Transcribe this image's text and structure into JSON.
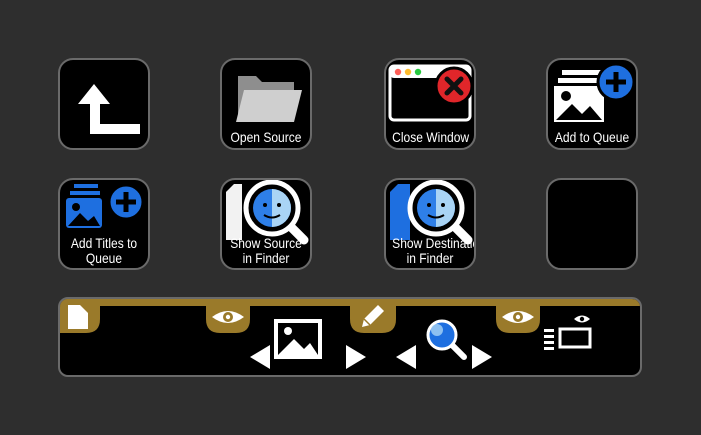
{
  "keys": {
    "back": {
      "label": ""
    },
    "open_source": {
      "label": "Open Source"
    },
    "close_window": {
      "label": "Close Window"
    },
    "add_to_queue": {
      "label": "Add to Queue"
    },
    "add_titles": {
      "line1": "Add Titles to",
      "line2": "Queue"
    },
    "show_source": {
      "line1": "Show Source",
      "line2": "in Finder"
    },
    "show_destination": {
      "line1": "Show Destination",
      "line2": "in Finder"
    },
    "empty": {
      "label": ""
    }
  },
  "icons": {
    "back": "up-left-arrow-icon",
    "open_source": "folder-icon",
    "close_window": "close-window-icon",
    "add_to_queue": "add-to-queue-icon",
    "add_titles": "add-titles-icon",
    "show_source": "finder-search-icon",
    "show_destination": "finder-search-icon",
    "bar": [
      "document-icon",
      "eye-icon",
      "image-icon",
      "pencil-icon",
      "magnifier-icon",
      "eye-icon",
      "list-preview-icon"
    ]
  },
  "colors": {
    "background": "#2e2e2e",
    "key_fill": "#000000",
    "key_border": "#6a6a6a",
    "gold": "#9a7a2a",
    "blue": "#1e6fe0",
    "red": "#e0262a"
  }
}
